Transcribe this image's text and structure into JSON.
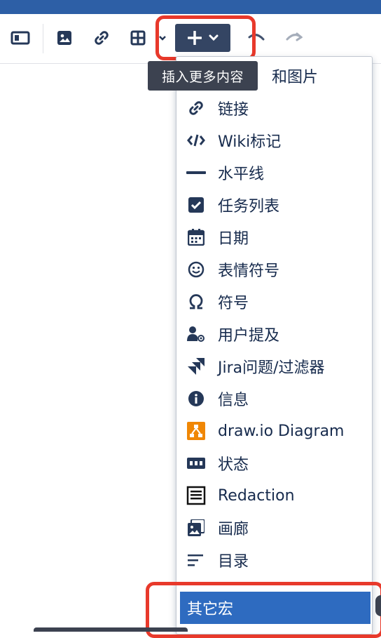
{
  "tooltip": {
    "text": "插入更多内容"
  },
  "menu": {
    "partial_top_label": "和图片",
    "items": [
      {
        "label": "链接",
        "icon": "link-icon"
      },
      {
        "label": "Wiki标记",
        "icon": "code-icon"
      },
      {
        "label": "水平线",
        "icon": "horizontal-line-icon"
      },
      {
        "label": "任务列表",
        "icon": "task-checkbox-icon"
      },
      {
        "label": "日期",
        "icon": "calendar-icon"
      },
      {
        "label": "表情符号",
        "icon": "emoji-icon"
      },
      {
        "label": "符号",
        "icon": "omega-icon"
      },
      {
        "label": "用户提及",
        "icon": "user-mention-icon"
      },
      {
        "label": "Jira问题/过滤器",
        "icon": "jira-icon"
      },
      {
        "label": "信息",
        "icon": "info-icon"
      },
      {
        "label": "draw.io Diagram",
        "icon": "drawio-icon"
      },
      {
        "label": "状态",
        "icon": "status-icon"
      },
      {
        "label": "Redaction",
        "icon": "redaction-icon"
      },
      {
        "label": "画廊",
        "icon": "gallery-icon"
      },
      {
        "label": "目录",
        "icon": "toc-icon"
      }
    ],
    "selected_item": {
      "label": "其它宏"
    }
  },
  "colors": {
    "accent_blue": "#2e6bc0",
    "toolbar_dark": "#344563",
    "highlight_red": "#e8392b"
  }
}
